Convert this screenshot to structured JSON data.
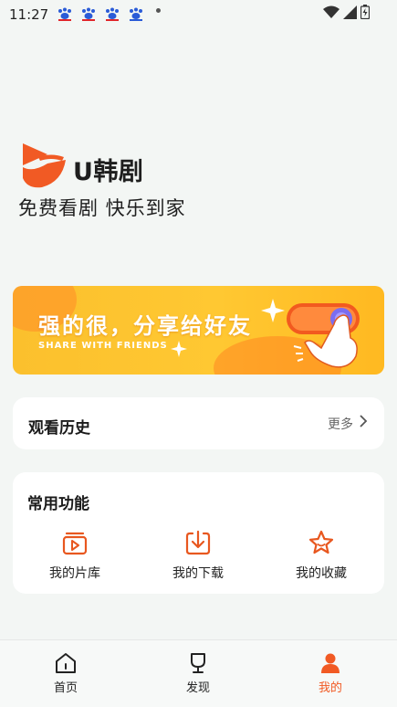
{
  "status_bar": {
    "time": "11:27"
  },
  "app": {
    "name": "U韩剧",
    "slogan": "免费看剧 快乐到家"
  },
  "banner": {
    "title": "强的很，分享给好友",
    "subtitle": "SHARE WITH FRIENDS"
  },
  "history": {
    "title": "观看历史",
    "more_label": "更多"
  },
  "functions": {
    "title": "常用功能",
    "items": [
      {
        "label": "我的片库",
        "icon": "library-icon"
      },
      {
        "label": "我的下载",
        "icon": "download-icon"
      },
      {
        "label": "我的收藏",
        "icon": "star-icon"
      }
    ]
  },
  "bottom_nav": {
    "items": [
      {
        "label": "首页",
        "icon": "home-icon",
        "active": false
      },
      {
        "label": "发现",
        "icon": "trophy-icon",
        "active": false
      },
      {
        "label": "我的",
        "icon": "user-icon",
        "active": true
      }
    ]
  },
  "colors": {
    "accent": "#f15a24",
    "banner": "#fbc02d",
    "background": "#f3f6f4"
  }
}
